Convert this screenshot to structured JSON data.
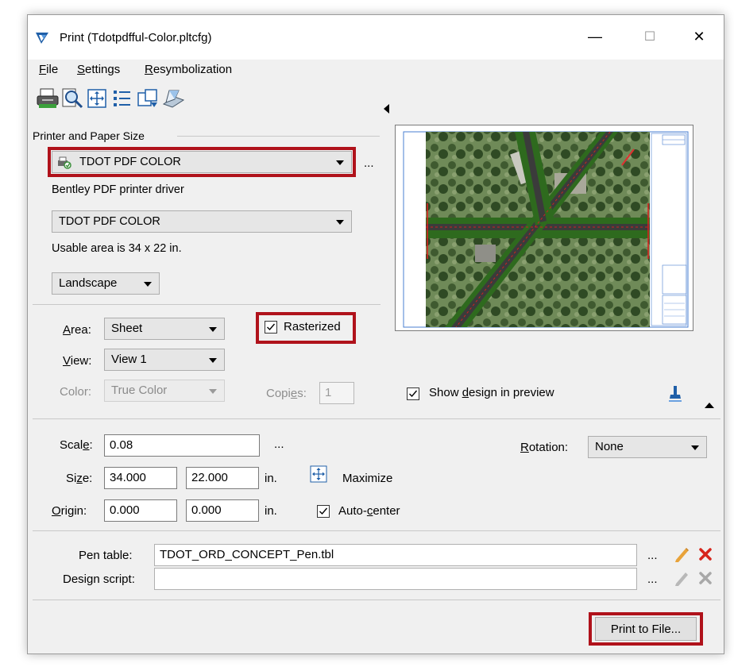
{
  "window": {
    "title": "Print  (Tdotpdfful-Color.pltcfg)",
    "controls": {
      "minimize": "—",
      "maximize": "☐",
      "close": "✕"
    }
  },
  "menu": [
    {
      "label": "File",
      "underline": "F",
      "rest": "ile"
    },
    {
      "label": "Settings",
      "underline": "S",
      "rest": "ettings"
    },
    {
      "label": "Resymbolization",
      "underline": "R",
      "rest": "esymbolization"
    }
  ],
  "toolbar": {
    "icons": [
      "print-icon",
      "preview-zoom-icon",
      "fit-view-icon",
      "list-icon",
      "page-setup-icon",
      "print-to-file-icon"
    ]
  },
  "printer_section": {
    "label": "Printer and Paper Size",
    "printer_select": "TDOT PDF COLOR",
    "more": "...",
    "driver_text": "Bentley PDF printer driver",
    "paper_select": "TDOT PDF COLOR",
    "usable_area": "Usable area is 34 x 22 in.",
    "orientation_select": "Landscape"
  },
  "area_section": {
    "area_label": "Area:",
    "area_value": "Sheet",
    "view_label": "View:",
    "view_value": "View 1",
    "color_label": "Color:",
    "color_value": "True Color",
    "rasterized_label": "Rasterized",
    "rasterized_checked": true,
    "copies_label": "Copies:",
    "copies_value": "1",
    "show_design_label": "Show design in preview",
    "show_design_checked": true
  },
  "scale_section": {
    "scale_label": "Scale:",
    "scale_value": "0.08",
    "more": "...",
    "rotation_label": "Rotation:",
    "rotation_value": "None",
    "size_label": "Size:",
    "size_w": "34.000",
    "size_h": "22.000",
    "size_unit": "in.",
    "maximize_label": "Maximize",
    "origin_label": "Origin:",
    "origin_x": "0.000",
    "origin_y": "0.000",
    "origin_unit": "in.",
    "autocenter_label": "Auto-center",
    "autocenter_checked": true
  },
  "pen_section": {
    "pen_label": "Pen table:",
    "pen_value": "TDOT_ORD_CONCEPT_Pen.tbl",
    "design_label": "Design script:",
    "design_value": "",
    "more": "..."
  },
  "footer": {
    "print_button": "Print to File..."
  },
  "colors": {
    "highlight": "#b0121b",
    "edit_icon": "#e8a33a",
    "delete_icon": "#d7251b"
  }
}
